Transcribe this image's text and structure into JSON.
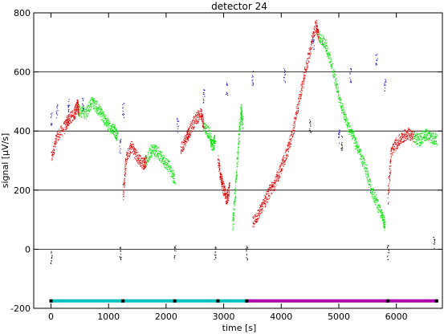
{
  "chart_data": {
    "type": "scatter",
    "title": "detector 24",
    "xlabel": "time [s]",
    "ylabel": "signal [μV/s]",
    "xlim": [
      -300,
      6800
    ],
    "ylim": [
      -200,
      800
    ],
    "xticks": [
      0,
      1000,
      2000,
      3000,
      4000,
      5000,
      6000
    ],
    "yticks": [
      -200,
      0,
      200,
      400,
      600,
      800
    ],
    "grid_y": [
      0,
      200,
      400,
      600
    ],
    "colors": {
      "red": "#e00000",
      "green": "#00e000",
      "blue": "#0000cc",
      "black": "#000000",
      "cyan": "#00c0c0",
      "magenta": "#b000b0",
      "grid": "#000000"
    },
    "red_segments": [
      [
        [
          0,
          310
        ],
        [
          100,
          380
        ],
        [
          250,
          420
        ],
        [
          300,
          440
        ],
        [
          400,
          460
        ],
        [
          450,
          490
        ],
        [
          480,
          470
        ]
      ],
      [
        [
          1250,
          180
        ],
        [
          1300,
          310
        ],
        [
          1400,
          350
        ],
        [
          1500,
          310
        ],
        [
          1600,
          290
        ],
        [
          1650,
          300
        ]
      ],
      [
        [
          2250,
          340
        ],
        [
          2350,
          380
        ],
        [
          2400,
          400
        ],
        [
          2500,
          440
        ],
        [
          2600,
          460
        ],
        [
          2650,
          420
        ]
      ],
      [
        [
          2900,
          300
        ],
        [
          2950,
          240
        ],
        [
          3000,
          200
        ],
        [
          3050,
          170
        ],
        [
          3100,
          210
        ]
      ],
      [
        [
          3500,
          90
        ],
        [
          3600,
          120
        ],
        [
          3700,
          160
        ],
        [
          3800,
          200
        ],
        [
          3900,
          230
        ],
        [
          4000,
          280
        ],
        [
          4100,
          330
        ],
        [
          4200,
          400
        ],
        [
          4300,
          500
        ],
        [
          4400,
          590
        ],
        [
          4500,
          680
        ],
        [
          4600,
          760
        ],
        [
          4650,
          720
        ]
      ],
      [
        [
          5850,
          170
        ],
        [
          5900,
          330
        ],
        [
          6000,
          360
        ],
        [
          6100,
          380
        ],
        [
          6200,
          395
        ],
        [
          6300,
          380
        ]
      ]
    ],
    "green_segments": [
      [
        [
          480,
          470
        ],
        [
          600,
          460
        ],
        [
          700,
          500
        ],
        [
          800,
          480
        ],
        [
          900,
          450
        ],
        [
          1000,
          420
        ],
        [
          1100,
          400
        ],
        [
          1150,
          380
        ]
      ],
      [
        [
          1650,
          300
        ],
        [
          1750,
          340
        ],
        [
          1850,
          330
        ],
        [
          1950,
          300
        ],
        [
          2050,
          280
        ],
        [
          2150,
          230
        ]
      ],
      [
        [
          2650,
          420
        ],
        [
          2750,
          390
        ],
        [
          2800,
          350
        ],
        [
          2850,
          370
        ]
      ],
      [
        [
          3150,
          80
        ],
        [
          3200,
          200
        ],
        [
          3250,
          350
        ],
        [
          3300,
          480
        ],
        [
          3320,
          420
        ]
      ],
      [
        [
          4650,
          720
        ],
        [
          4750,
          700
        ],
        [
          4850,
          640
        ],
        [
          4950,
          560
        ],
        [
          5050,
          480
        ],
        [
          5150,
          420
        ],
        [
          5250,
          380
        ],
        [
          5350,
          330
        ],
        [
          5450,
          280
        ],
        [
          5550,
          210
        ],
        [
          5650,
          160
        ],
        [
          5750,
          110
        ],
        [
          5800,
          80
        ]
      ],
      [
        [
          6300,
          380
        ],
        [
          6400,
          370
        ],
        [
          6500,
          390
        ],
        [
          6600,
          380
        ],
        [
          6700,
          370
        ]
      ]
    ],
    "blue_clusters": [
      [
        0,
        440
      ],
      [
        100,
        470
      ],
      [
        300,
        490
      ],
      [
        550,
        490
      ],
      [
        1200,
        350
      ],
      [
        1250,
        470
      ],
      [
        2200,
        420
      ],
      [
        2650,
        520
      ],
      [
        3050,
        540
      ],
      [
        3500,
        580
      ],
      [
        4050,
        590
      ],
      [
        4550,
        700
      ],
      [
        5000,
        380
      ],
      [
        5200,
        590
      ],
      [
        5650,
        640
      ],
      [
        5800,
        560
      ]
    ],
    "black_clusters": [
      [
        0,
        -30
      ],
      [
        1200,
        -10
      ],
      [
        2150,
        -10
      ],
      [
        2850,
        -10
      ],
      [
        3400,
        -10
      ],
      [
        4500,
        420
      ],
      [
        5050,
        360
      ],
      [
        5850,
        -10
      ],
      [
        6650,
        20
      ]
    ],
    "bars": [
      {
        "color": "cyan",
        "x0": 0,
        "x1": 3400,
        "y": -175
      },
      {
        "color": "magenta",
        "x0": 3400,
        "x1": 6700,
        "y": -175
      }
    ],
    "bar_markers": [
      0,
      1250,
      2150,
      2900,
      3400,
      5850,
      6700
    ]
  }
}
